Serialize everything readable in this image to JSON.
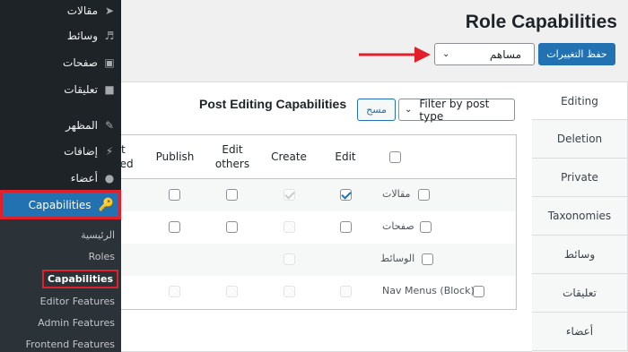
{
  "sidebar": {
    "items": [
      {
        "label": "مقالات",
        "icon": "pin-icon"
      },
      {
        "label": "وسائط",
        "icon": "media-icon"
      },
      {
        "label": "صفحات",
        "icon": "pages-icon"
      },
      {
        "label": "تعليقات",
        "icon": "comment-icon"
      },
      {
        "label": "المظهر",
        "icon": "brush-icon"
      },
      {
        "label": "إضافات",
        "icon": "plugin-icon"
      },
      {
        "label": "أعضاء",
        "icon": "user-icon"
      }
    ],
    "capabilities_label": "Capabilities",
    "submenu": [
      "الرئيسية",
      "Roles",
      "Capabilities",
      "Editor Features",
      "Admin Features",
      "Frontend Features"
    ]
  },
  "header": {
    "title": "Role Capabilities",
    "save_label": "حفظ التغييرات",
    "role_value": "مساهم"
  },
  "tabs": [
    "Editing",
    "Deletion",
    "Private",
    "Taxonomies",
    "وسائط",
    "تعليقات",
    "أعضاء"
  ],
  "panel": {
    "title": "Post Editing Capabilities",
    "clear_label": "مسح",
    "filter_label": "Filter by post type"
  },
  "table": {
    "columns": [
      "Edit",
      "Create",
      "Edit\nothers",
      "Publish",
      "t\nned"
    ],
    "rows": [
      {
        "label": "مقالات",
        "edit_checked": true,
        "create_checked": true
      },
      {
        "label": "صفحات",
        "edit_checked": false,
        "create_checked": false
      },
      {
        "label": "الوسائط",
        "edit_checked": false,
        "create_checked": false
      },
      {
        "label": "Nav Menus (Block)",
        "edit_checked": false,
        "create_checked": false
      }
    ]
  },
  "colors": {
    "accent": "#2271b1",
    "highlight": "#e0202b",
    "sidebar": "#1d2327"
  }
}
